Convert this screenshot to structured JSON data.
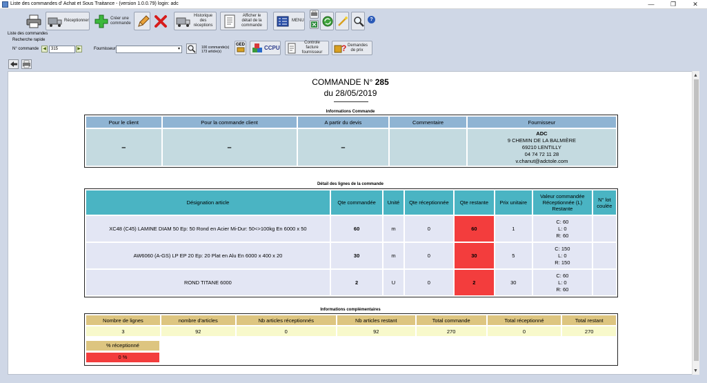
{
  "window": {
    "title": "Liste des commandes d' Achat et Sous Traitance - (version 1.0.0.79) login: adc",
    "minimize": "—",
    "restore": "❐",
    "close": "✕"
  },
  "toolbar": {
    "receptionner": "Réceptionner",
    "creer_commande": "Créer une commande",
    "historique": "Historique des réceptions",
    "afficher_detail": "Afficher le détail de la commande",
    "menu": "MENU",
    "help": "?"
  },
  "filters": {
    "liste_label": "Liste des commandes",
    "recherche_label": "Recherche rapide",
    "ncommande_label": "N° commande",
    "ncommande_value": "315",
    "fournisseur_label": "Fournisseur",
    "fournisseur_value": "",
    "count_commandes": "100 commande(s)",
    "count_articles": "173 article(s)",
    "ged": "GED",
    "ccpu": "CCPU",
    "controle_facture": "Controle facture fournisseur",
    "demandes_prix": "Demandes de prix"
  },
  "document": {
    "title_prefix": "COMMANDE N°",
    "number": "285",
    "date_line": "du 28/05/2019",
    "info_section": "Informations Commande",
    "info_headers": [
      "Pour le client",
      "Pour la commande client",
      "A partir du devis",
      "Commentaire",
      "Fournisseur"
    ],
    "info_values": [
      "–",
      "–",
      "–",
      ""
    ],
    "fournisseur": {
      "name": "ADC",
      "address": "9 CHEMIN DE LA BALMIÈRE",
      "city": "69210 LENTILLY",
      "phone": "04 74 72 11 28",
      "email": "v.chanut@adctole.com"
    },
    "detail_section": "Détail des lignes de la commande",
    "detail_headers": {
      "designation": "Désignation article",
      "qte_commandee": "Qte commandée",
      "unite": "Unité",
      "qte_receptionnee": "Qte réceptionnée",
      "qte_restante": "Qte restante",
      "prix_unitaire": "Prix unitaire",
      "valeur_1": "Valeur commandée",
      "valeur_2": "Réceptionnée (L)",
      "valeur_3": "Restante",
      "lot_1": "N° lot",
      "lot_2": "coulée"
    },
    "lines": [
      {
        "designation": "XC48 (C45) LAMINE DIAM 50 Ep: 50 Rond en Acier Mi-Dur: 50<>100kg En      6000 x 50",
        "qte_commandee": "60",
        "unite": "m",
        "qte_receptionnee": "0",
        "qte_restante": "60",
        "prix_unitaire": "1",
        "c": "C: 60",
        "l": "L: 0",
        "r": "R: 60",
        "lot": ""
      },
      {
        "designation": "AW6060 (A-GS) LP EP 20 Ep: 20 Plat en Alu En      6000 x 400 x 20",
        "qte_commandee": "30",
        "unite": "m",
        "qte_receptionnee": "0",
        "qte_restante": "30",
        "prix_unitaire": "5",
        "c": "C: 150",
        "l": "L: 0",
        "r": "R: 150",
        "lot": ""
      },
      {
        "designation": "ROND TITANE 6000",
        "qte_commandee": "2",
        "unite": "U",
        "qte_receptionnee": "0",
        "qte_restante": "2",
        "prix_unitaire": "30",
        "c": "C: 60",
        "l": "L: 0",
        "r": "R: 60",
        "lot": ""
      }
    ],
    "compl_section": "Informations complémentaires",
    "compl_headers": [
      "Nombre de lignes",
      "nombre d'articles",
      "Nb articles réceptionnés",
      "Nb articles restant",
      "Total commande",
      "Total réceptionné",
      "Total restant"
    ],
    "compl_values": [
      "3",
      "92",
      "0",
      "92",
      "270",
      "0",
      "270"
    ],
    "pct_label": "% réceptionné",
    "pct_value": "0 %"
  },
  "colors": {
    "toolbar_bg": "#cfd7e6",
    "info_header": "#8fb4d3",
    "detail_header": "#4ab4c3",
    "alert_red": "#f33d3d",
    "compl_header": "#ddc580",
    "compl_value": "#f8f9cb"
  }
}
